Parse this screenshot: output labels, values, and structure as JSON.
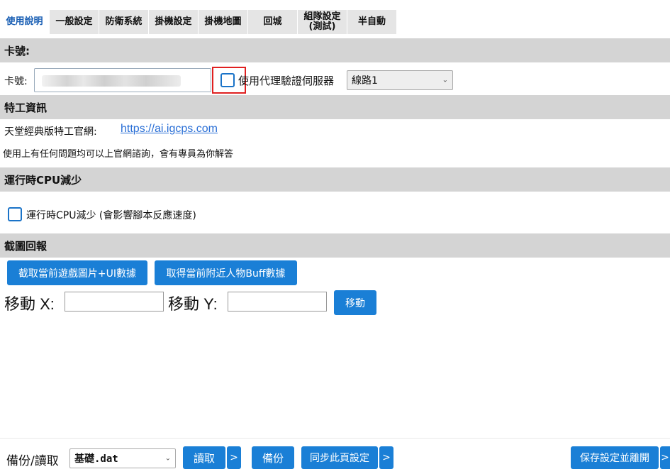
{
  "tabs": [
    {
      "label": "使用說明",
      "active": true
    },
    {
      "label": "一般設定"
    },
    {
      "label": "防衛系統"
    },
    {
      "label": "掛機設定"
    },
    {
      "label": "掛機地圖"
    },
    {
      "label": "回城"
    },
    {
      "label_line1": "組隊設定",
      "label_line2": "(測試)"
    },
    {
      "label": "半自動"
    }
  ],
  "card_section": {
    "title": "卡號:",
    "card_label": "卡號:",
    "card_value": "",
    "proxy_checkbox_label": "使用代理驗證伺服器",
    "proxy_checked": false,
    "route_select_value": "線路1"
  },
  "agent_section": {
    "title": "特工資訊",
    "site_label": "天堂經典版特工官網:",
    "site_link": "https://ai.igcps.com",
    "help_text": "使用上有任何問題均可以上官網諮詢，會有專員為你解答"
  },
  "cpu_section": {
    "title": "運行時CPU減少",
    "checkbox_label": "運行時CPU減少 (會影響腳本反應速度)",
    "checked": false
  },
  "screenshot_section": {
    "title": "截圖回報",
    "capture_button": "截取當前遊戲圖片+UI數據",
    "buff_button": "取得當前附近人物Buff數據",
    "move_x_label": "移動 X:",
    "move_y_label": "移動 Y:",
    "move_x_value": "",
    "move_y_value": "",
    "move_button": "移動"
  },
  "footer": {
    "backup_label": "備份/讀取",
    "file_select_value": "基礎.dat",
    "read_button": "讀取",
    "more_button": ">",
    "backup_button": "備份",
    "sync_button": "同步此頁設定",
    "sync_more_button": ">",
    "save_exit_button": "保存設定並離開",
    "save_more_button": ">"
  },
  "colors": {
    "accent": "#1a7fd6",
    "section_bg": "#d4d4d4",
    "tab_bg": "#e5e5e5",
    "highlight": "#e02020",
    "link": "#2a6fd6"
  }
}
